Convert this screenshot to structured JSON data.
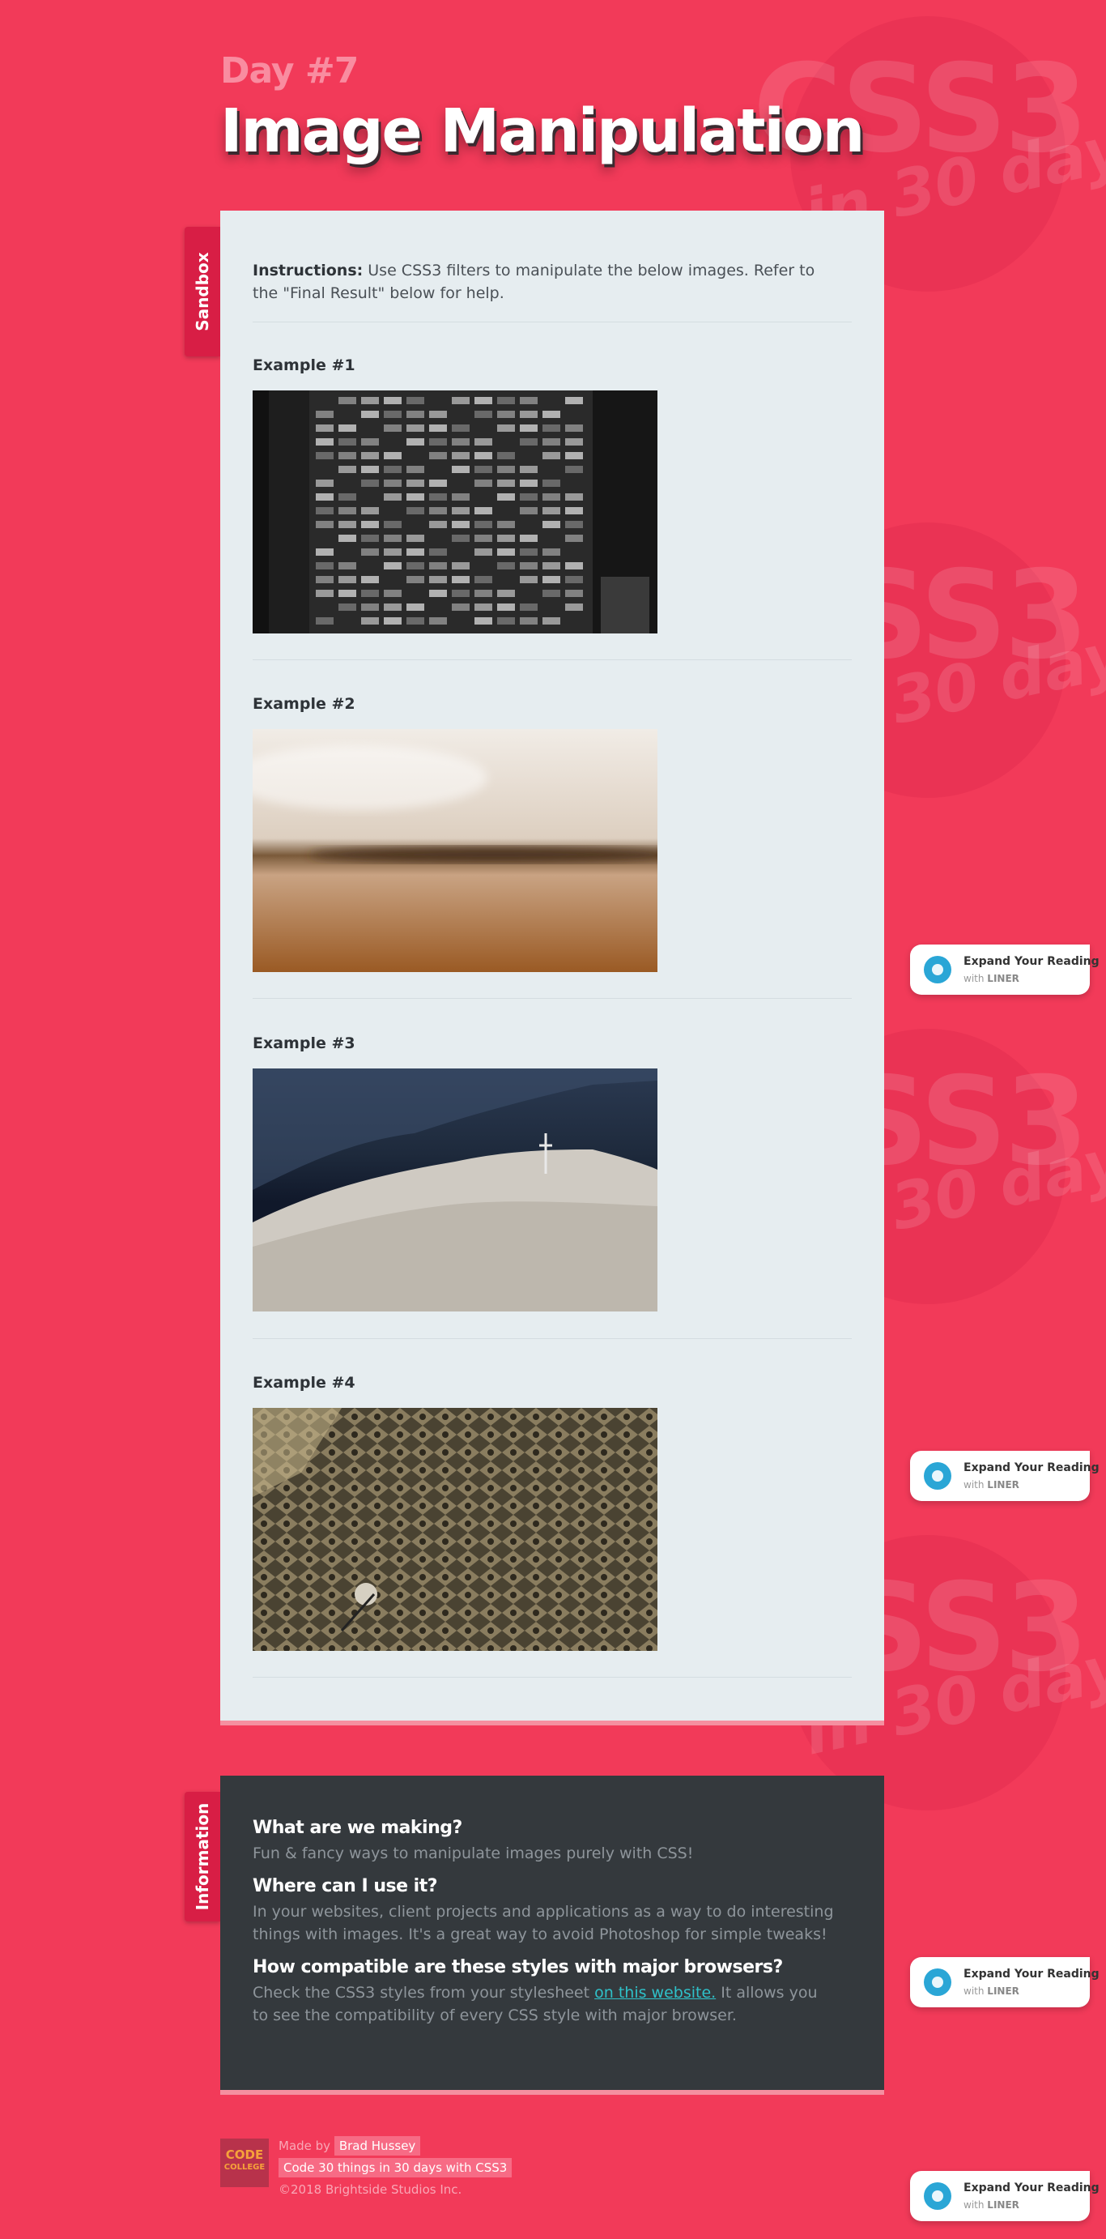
{
  "watermark": {
    "big": "CSS3",
    "small": "in 30 days"
  },
  "header": {
    "day": "Day #7",
    "title": "Image Manipulation"
  },
  "sandbox": {
    "tab": "Sandbox",
    "instructions_label": "Instructions:",
    "instructions_text": " Use CSS3 filters to manipulate the below images. Refer to the \"Final Result\" below for help.",
    "examples": [
      {
        "label": "Example #1"
      },
      {
        "label": "Example #2"
      },
      {
        "label": "Example #3"
      },
      {
        "label": "Example #4"
      }
    ]
  },
  "info": {
    "tab": "Information",
    "items": [
      {
        "question": "What are we making?",
        "answer": "Fun & fancy ways to manipulate images purely with CSS!"
      },
      {
        "question": "Where can I use it?",
        "answer": "In your websites, client projects and applications as a way to do interesting things with images. It's a great way to avoid Photoshop for simple tweaks!"
      },
      {
        "question": "How compatible are these styles with major browsers?",
        "answer_before": "Check the CSS3 styles from your stylesheet ",
        "answer_link": "on this website.",
        "answer_after": " It allows you to see the compatibility of every CSS style with major browser."
      }
    ]
  },
  "footer": {
    "logo_top": "CODE",
    "logo_bottom": "COLLEGE",
    "made_by": "Made by",
    "author": "Brad Hussey",
    "course": "Code 30 things in 30 days with CSS3",
    "copyright": "©2018 Brightside Studios Inc."
  },
  "liner": {
    "title": "Expand Your Reading",
    "with": "with",
    "brand": "LINER"
  },
  "colors": {
    "background": "#f23a59",
    "sandbox": "#e6edf0",
    "info": "#34393d",
    "tab": "#d81e45",
    "link": "#2fc1c9"
  }
}
